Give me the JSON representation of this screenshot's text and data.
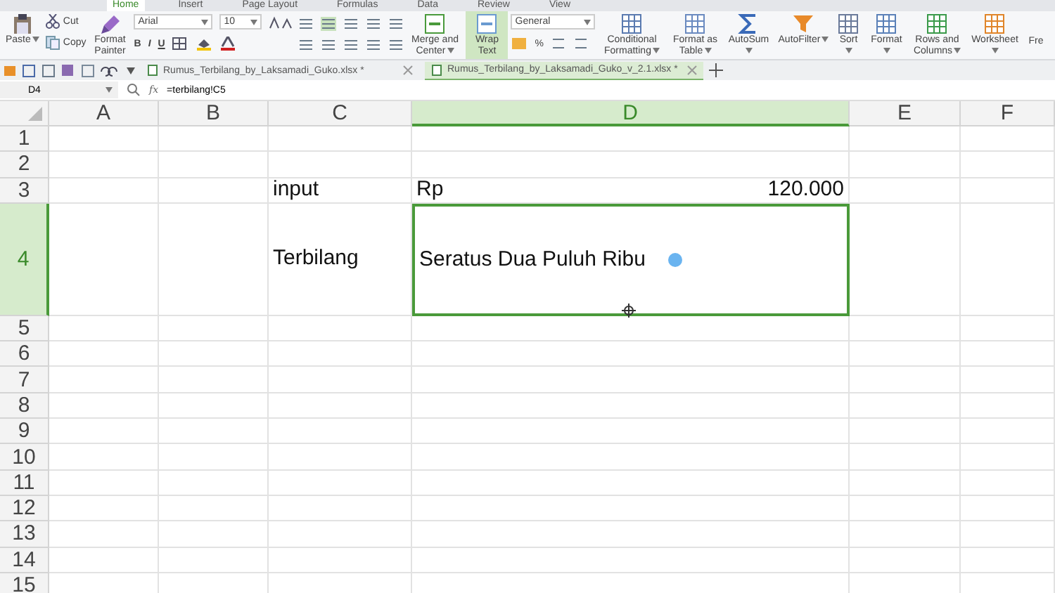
{
  "menu_tabs": [
    {
      "label": "Home",
      "selected": true
    },
    {
      "label": "Insert",
      "selected": false
    },
    {
      "label": "Page Layout",
      "selected": false
    },
    {
      "label": "Formulas",
      "selected": false
    },
    {
      "label": "Data",
      "selected": false
    },
    {
      "label": "Review",
      "selected": false
    },
    {
      "label": "View",
      "selected": false
    }
  ],
  "ribbon": {
    "paste": {
      "label": "Paste",
      "dropdown": true
    },
    "clipboard_small": [
      {
        "label": "Cut"
      },
      {
        "label": "Copy"
      }
    ],
    "format_painter": {
      "label": "Format Painter"
    },
    "font": {
      "name": "Arial",
      "size": "10",
      "styles": [
        "B",
        "I",
        "U"
      ]
    },
    "large_buttons": [
      {
        "label": "Merge and Center",
        "dropdown": true,
        "selected": false
      },
      {
        "label": "Wrap Text",
        "dropdown": false,
        "selected": true
      }
    ],
    "number": {
      "format": "General",
      "percent": "%"
    },
    "more_buttons": [
      {
        "label": "Conditional Formatting",
        "dropdown": true
      },
      {
        "label": "Format as Table",
        "dropdown": true
      },
      {
        "label": "AutoSum",
        "dropdown": true
      },
      {
        "label": "AutoFilter",
        "dropdown": true
      },
      {
        "label": "Sort",
        "dropdown": true
      },
      {
        "label": "Format",
        "dropdown": true
      },
      {
        "label": "Rows and Columns",
        "dropdown": true
      },
      {
        "label": "Worksheet",
        "dropdown": true
      },
      {
        "label": "Fre",
        "dropdown": false
      }
    ]
  },
  "doc_tabs": [
    {
      "label": "Rumus_Terbilang_by_Laksamadi_Guko.xlsx *",
      "selected": false
    },
    {
      "label": "Rumus_Terbilang_by_Laksamadi_Guko_v_2.1.xlsx *",
      "selected": true
    }
  ],
  "formula_bar": {
    "name_box": "D4",
    "fx": "fx",
    "formula": "=terbilang!C5"
  },
  "columns": [
    {
      "label": "A",
      "selected": false
    },
    {
      "label": "B",
      "selected": false
    },
    {
      "label": "C",
      "selected": false
    },
    {
      "label": "D",
      "selected": true
    },
    {
      "label": "E",
      "selected": false
    },
    {
      "label": "F",
      "selected": false
    }
  ],
  "rows": [
    {
      "header": "1",
      "selected": false
    },
    {
      "header": "2",
      "selected": false
    },
    {
      "header": "3",
      "selected": false,
      "column_c": {
        "text": "input"
      },
      "column_d": {
        "text": "Rp",
        "value": "120.000"
      }
    },
    {
      "header": "4",
      "selected": true,
      "column_c": {
        "text": "Terbilang"
      },
      "column_d": {
        "text": "Seratus Dua Puluh Ribu"
      }
    },
    {
      "header": "5",
      "selected": false
    },
    {
      "header": "6",
      "selected": false
    },
    {
      "header": "7",
      "selected": false
    },
    {
      "header": "8",
      "selected": false
    },
    {
      "header": "9",
      "selected": false
    },
    {
      "header": "10",
      "selected": false
    },
    {
      "header": "11",
      "selected": false
    },
    {
      "header": "12",
      "selected": false
    },
    {
      "header": "13",
      "selected": false
    },
    {
      "header": "14",
      "selected": false
    },
    {
      "header": "15",
      "selected": false
    }
  ]
}
